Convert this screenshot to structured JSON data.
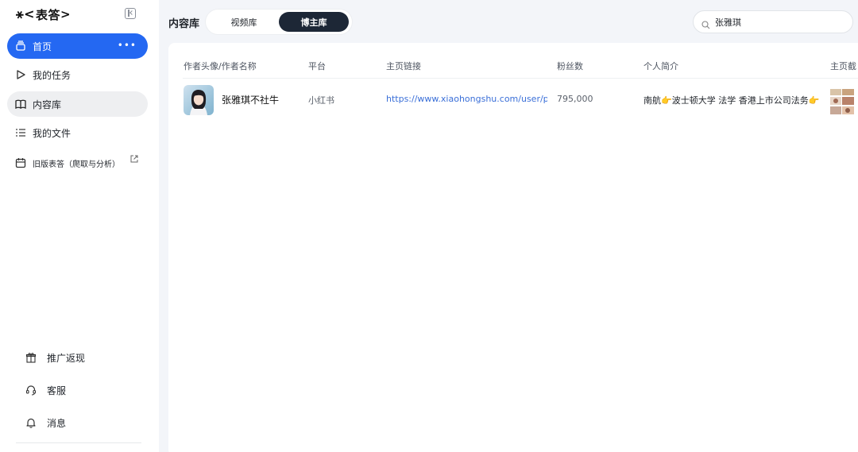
{
  "app": {
    "logo_text": "表答",
    "logo_prefix": "⚹<",
    "logo_suffix": ">"
  },
  "sidebar": {
    "items": [
      {
        "label": "首页",
        "icon": "home-icon",
        "more": "•••"
      },
      {
        "label": "我的任务",
        "icon": "play-icon"
      },
      {
        "label": "内容库",
        "icon": "book-icon"
      },
      {
        "label": "我的文件",
        "icon": "list-icon"
      },
      {
        "label": "旧版表答（爬取与分析）",
        "icon": "calendar-icon"
      }
    ],
    "bottom": [
      {
        "label": "推广返现",
        "icon": "gift-icon"
      },
      {
        "label": "客服",
        "icon": "headset-icon"
      },
      {
        "label": "消息",
        "icon": "bell-icon"
      }
    ]
  },
  "header": {
    "title": "内容库",
    "tabs": [
      {
        "label": "视频库",
        "active": false
      },
      {
        "label": "博主库",
        "active": true
      }
    ],
    "search_value": "张雅琪"
  },
  "table": {
    "columns": [
      "作者头像/作者名称",
      "平台",
      "主页链接",
      "粉丝数",
      "个人简介",
      "主页截"
    ],
    "rows": [
      {
        "name": "张雅琪不社牛",
        "platform": "小红书",
        "url": "https://www.xiaohongshu.com/user/profile",
        "followers": "795,000",
        "bio": "南航👉波士顿大学 法学 香港上市公司法务👉"
      }
    ]
  },
  "colors": {
    "accent": "#2468f2",
    "tab_active": "#1d2736",
    "link": "#3a6fd8"
  }
}
